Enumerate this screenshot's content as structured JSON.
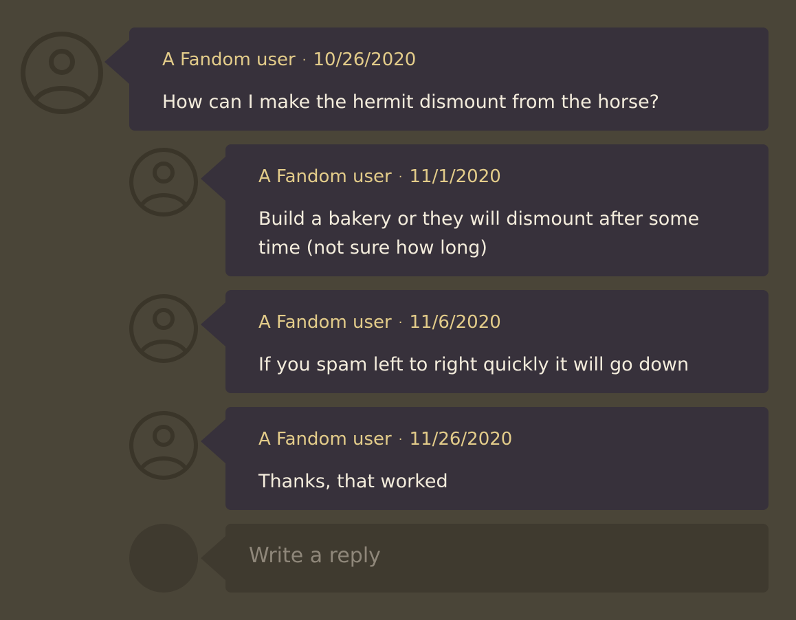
{
  "comments": [
    {
      "author": "A Fandom user",
      "separator": "·",
      "date": "10/26/2020",
      "text": "How can I make the hermit dismount from the horse?"
    },
    {
      "author": "A Fandom user",
      "separator": "·",
      "date": "11/1/2020",
      "text": "Build a bakery or they will dismount after some time (not sure how long)"
    },
    {
      "author": "A Fandom user",
      "separator": "·",
      "date": "11/6/2020",
      "text": "If you spam left to right quickly it will go down"
    },
    {
      "author": "A Fandom user",
      "separator": "·",
      "date": "11/26/2020",
      "text": "Thanks, that worked"
    }
  ],
  "reply": {
    "placeholder": "Write a reply"
  },
  "colors": {
    "background": "#4a4538",
    "bubble": "#37313b",
    "author_and_date": "#e3cc8a",
    "text": "#f3ecdc",
    "reply_box": "#3f3a2f"
  },
  "icons": {
    "avatar": "user-avatar-icon"
  }
}
